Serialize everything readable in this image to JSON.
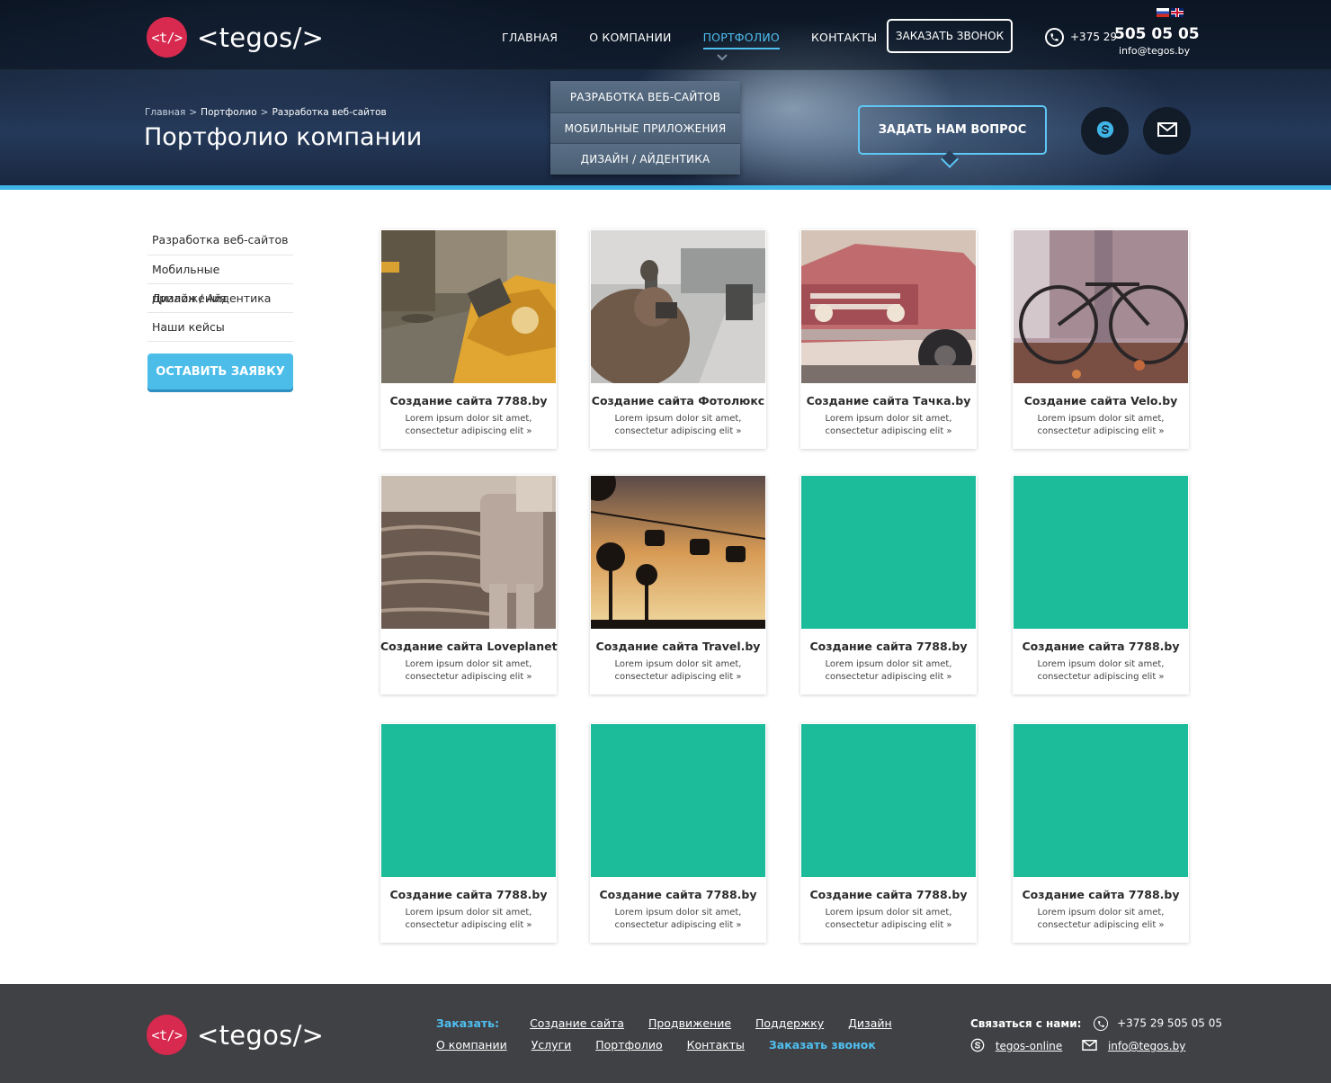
{
  "header": {
    "logo_mark": "<t/>",
    "logo_text": "<tegos/>",
    "nav": [
      "ГЛАВНАЯ",
      "О КОМПАНИИ",
      "ПОРТФОЛИО",
      "КОНТАКТЫ"
    ],
    "callback_label": "ЗАКАЗАТЬ ЗВОНОК",
    "phone_prefix": "+375 29",
    "phone_main": "505 05 05",
    "email": "info@tegos.by",
    "languages": [
      "RU",
      "EN"
    ]
  },
  "dropdown": [
    "РАЗРАБОТКА ВЕБ-САЙТОВ",
    "МОБИЛЬНЫЕ ПРИЛОЖЕНИЯ",
    "ДИЗАЙН / АЙДЕНТИКА"
  ],
  "breadcrumb": {
    "home": "Главная",
    "sep": ">",
    "portfolio": "Портфолио",
    "current": "Разработка веб-сайтов"
  },
  "page_title": "Портфолио компании",
  "ask_label": "ЗАДАТЬ НАМ ВОПРОС",
  "sidebar": {
    "items": [
      "Разработка веб-сайтов",
      "Мобильные приложения",
      "Дизайн / Айдентика",
      "Наши кейсы"
    ],
    "order_label": "ОСТАВИТЬ ЗАЯВКУ"
  },
  "card_desc_line1": "Lorem ipsum dolor sit amet,",
  "card_desc_line2": "consectetur adipiscing elit »",
  "cards": [
    {
      "title": "Создание сайта 7788.by",
      "image": "taxi-photo"
    },
    {
      "title": "Создание сайта Фотолюкс",
      "image": "photographer-photo"
    },
    {
      "title": "Создание сайта Тачка.by",
      "image": "old-car-photo"
    },
    {
      "title": "Создание сайта Velo.by",
      "image": "bicycle-photo"
    },
    {
      "title": "Создание сайта Loveplanet",
      "image": "child-photo"
    },
    {
      "title": "Создание сайта Travel.by",
      "image": "cable-car-photo"
    },
    {
      "title": "Создание сайта 7788.by",
      "image": "placeholder"
    },
    {
      "title": "Создание сайта 7788.by",
      "image": "placeholder"
    },
    {
      "title": "Создание сайта 7788.by",
      "image": "placeholder"
    },
    {
      "title": "Создание сайта 7788.by",
      "image": "placeholder"
    },
    {
      "title": "Создание сайта 7788.by",
      "image": "placeholder"
    },
    {
      "title": "Создание сайта 7788.by",
      "image": "placeholder"
    }
  ],
  "footer": {
    "order_label": "Заказать:",
    "row1_links": [
      "Создание сайта",
      "Продвижение",
      "Поддержку",
      "Дизайн"
    ],
    "row2_links": [
      "О компании",
      "Услуги",
      "Портфолио",
      "Контакты"
    ],
    "row2_accent": "Заказать звонок",
    "contact_label": "Связаться с нами:",
    "phone": "+375 29 505 05 05",
    "skype": "tegos-online",
    "email": "info@tegos.by"
  },
  "colors": {
    "accent": "#4fbff0",
    "brand_red": "#d8294f",
    "placeholder_teal": "#1cbc9b",
    "footer_bg": "#404144"
  }
}
